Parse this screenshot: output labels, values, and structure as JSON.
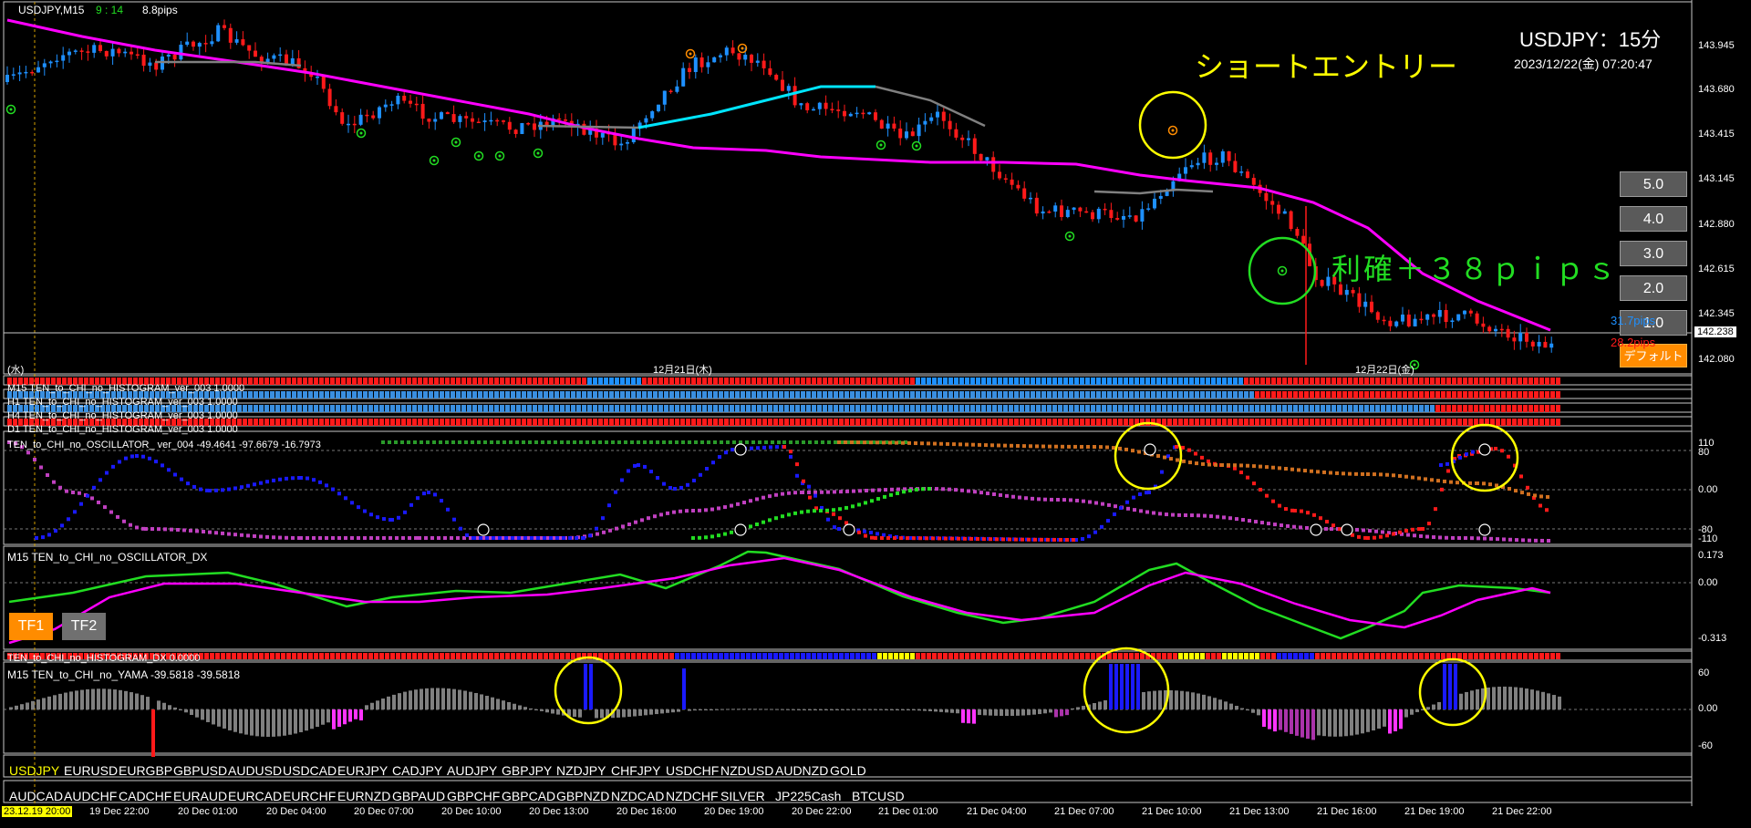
{
  "window": {
    "title": "USDJPY,M15",
    "timer": "9 : 14",
    "spread": "8.8pips"
  },
  "header": {
    "symbol_tf": "USDJPY：15分",
    "datetime": "2023/12/22(金) 07:20:47"
  },
  "annotations": {
    "short_entry": "ショートエントリー",
    "take_profit": "利確＋３８ｐｉｐｓ"
  },
  "price_axis": {
    "labels": [
      "143.945",
      "143.680",
      "143.415",
      "143.145",
      "142.880",
      "142.615",
      "142.345",
      "142.080"
    ],
    "current": "142.238"
  },
  "scale_buttons": [
    "5.0",
    "4.0",
    "3.0",
    "2.0",
    "1.0"
  ],
  "default_button": "デフォルト",
  "pips_blue": "31.7pips",
  "pips_red": "28.2pips",
  "date_markers": {
    "left": "(水)",
    "mid": "12月21日(木)",
    "right": "12月22日(金)"
  },
  "histograms": [
    {
      "label": "M15 TEN_to_CHI_no_HISTOGRAM_ver_003 1.0000"
    },
    {
      "label": "H1 TEN_to_CHI_no_HISTOGRAM_ver_003 1.0000"
    },
    {
      "label": "H4 TEN_to_CHI_no_HISTOGRAM_ver_003 1.0000"
    },
    {
      "label": "D1 TEN_to_CHI_no_HISTOGRAM_ver_003 1.0000"
    }
  ],
  "oscillator": {
    "label": "TEN_to_CHI_no_OSCILLATOR_ ver_004 -49.4641 -97.6679 -16.7973",
    "axis": [
      "110",
      "80",
      "0.00",
      "-80",
      "-110"
    ]
  },
  "dx": {
    "label": "M15 TEN_to_CHI_no_OSCILLATOR_DX",
    "axis": [
      "0.173",
      "0.00",
      "-0.313"
    ]
  },
  "hist_dx": {
    "label": "TEN_to_CHI_no_HISTOGRAM_DX 0.0000"
  },
  "yama": {
    "label": "M15 TEN_to_CHI_no_YAMA -39.5818 -39.5818",
    "axis": [
      "60",
      "0.00",
      "-60"
    ]
  },
  "tf_buttons": {
    "tf1": "TF1",
    "tf2": "TF2"
  },
  "symbols_row1": [
    "USDJPY",
    "EURUSD",
    "EURGBP",
    "GBPUSD",
    "AUDUSD",
    "USDCAD",
    "EURJPY",
    "CADJPY",
    "AUDJPY",
    "GBPJPY",
    "NZDJPY",
    "CHFJPY",
    "USDCHF",
    "NZDUSD",
    "AUDNZD",
    "GOLD"
  ],
  "symbols_row2": [
    "AUDCAD",
    "AUDCHF",
    "CADCHF",
    "EURAUD",
    "EURCAD",
    "EURCHF",
    "EURNZD",
    "GBPAUD",
    "GBPCHF",
    "GBPCAD",
    "GBPNZD",
    "NZDCAD",
    "NZDCHF",
    "SILVER",
    "JP225Cash",
    "BTCUSD"
  ],
  "time_axis": [
    "23.12.19 20:00",
    "19 Dec 22:00",
    "20 Dec 01:00",
    "20 Dec 04:00",
    "20 Dec 07:00",
    "20 Dec 10:00",
    "20 Dec 13:00",
    "20 Dec 16:00",
    "20 Dec 19:00",
    "20 Dec 22:00",
    "21 Dec 01:00",
    "21 Dec 04:00",
    "21 Dec 07:00",
    "21 Dec 10:00",
    "21 Dec 13:00",
    "21 Dec 16:00",
    "21 Dec 19:00",
    "21 Dec 22:00"
  ],
  "colors": {
    "bull": "#1e90ff",
    "bear": "#ff1a1a",
    "ma": "#ff00ff",
    "ma_flat": "#808080",
    "ma_up": "#00e5ff",
    "osc_up": "#1a1aff",
    "green": "#22dd22",
    "orange": "#ff8c00",
    "yellow": "#ffff00"
  }
}
